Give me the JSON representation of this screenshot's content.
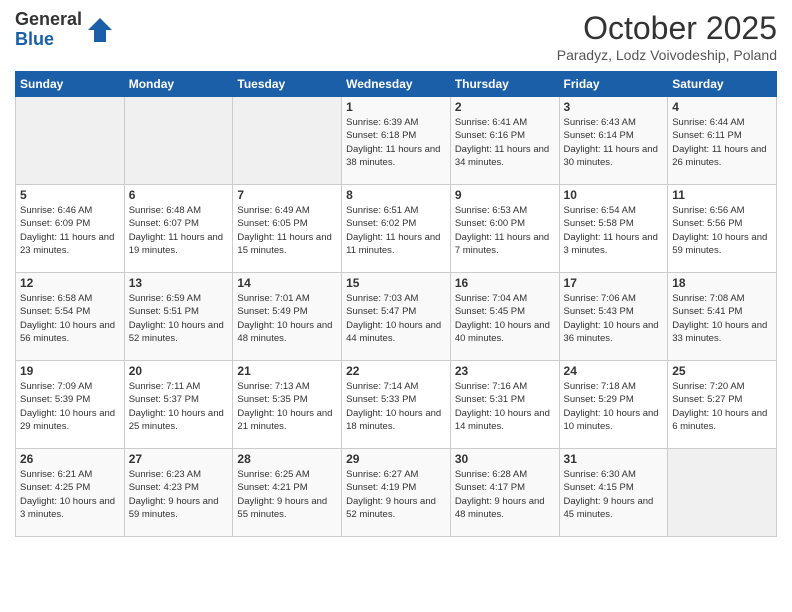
{
  "logo": {
    "general": "General",
    "blue": "Blue"
  },
  "header": {
    "month_title": "October 2025",
    "subtitle": "Paradyz, Lodz Voivodeship, Poland"
  },
  "weekdays": [
    "Sunday",
    "Monday",
    "Tuesday",
    "Wednesday",
    "Thursday",
    "Friday",
    "Saturday"
  ],
  "weeks": [
    [
      {
        "day": "",
        "empty": true
      },
      {
        "day": "",
        "empty": true
      },
      {
        "day": "",
        "empty": true
      },
      {
        "day": "1",
        "sunrise": "6:39 AM",
        "sunset": "6:18 PM",
        "daylight": "11 hours and 38 minutes."
      },
      {
        "day": "2",
        "sunrise": "6:41 AM",
        "sunset": "6:16 PM",
        "daylight": "11 hours and 34 minutes."
      },
      {
        "day": "3",
        "sunrise": "6:43 AM",
        "sunset": "6:14 PM",
        "daylight": "11 hours and 30 minutes."
      },
      {
        "day": "4",
        "sunrise": "6:44 AM",
        "sunset": "6:11 PM",
        "daylight": "11 hours and 26 minutes."
      }
    ],
    [
      {
        "day": "5",
        "sunrise": "6:46 AM",
        "sunset": "6:09 PM",
        "daylight": "11 hours and 23 minutes."
      },
      {
        "day": "6",
        "sunrise": "6:48 AM",
        "sunset": "6:07 PM",
        "daylight": "11 hours and 19 minutes."
      },
      {
        "day": "7",
        "sunrise": "6:49 AM",
        "sunset": "6:05 PM",
        "daylight": "11 hours and 15 minutes."
      },
      {
        "day": "8",
        "sunrise": "6:51 AM",
        "sunset": "6:02 PM",
        "daylight": "11 hours and 11 minutes."
      },
      {
        "day": "9",
        "sunrise": "6:53 AM",
        "sunset": "6:00 PM",
        "daylight": "11 hours and 7 minutes."
      },
      {
        "day": "10",
        "sunrise": "6:54 AM",
        "sunset": "5:58 PM",
        "daylight": "11 hours and 3 minutes."
      },
      {
        "day": "11",
        "sunrise": "6:56 AM",
        "sunset": "5:56 PM",
        "daylight": "10 hours and 59 minutes."
      }
    ],
    [
      {
        "day": "12",
        "sunrise": "6:58 AM",
        "sunset": "5:54 PM",
        "daylight": "10 hours and 56 minutes."
      },
      {
        "day": "13",
        "sunrise": "6:59 AM",
        "sunset": "5:51 PM",
        "daylight": "10 hours and 52 minutes."
      },
      {
        "day": "14",
        "sunrise": "7:01 AM",
        "sunset": "5:49 PM",
        "daylight": "10 hours and 48 minutes."
      },
      {
        "day": "15",
        "sunrise": "7:03 AM",
        "sunset": "5:47 PM",
        "daylight": "10 hours and 44 minutes."
      },
      {
        "day": "16",
        "sunrise": "7:04 AM",
        "sunset": "5:45 PM",
        "daylight": "10 hours and 40 minutes."
      },
      {
        "day": "17",
        "sunrise": "7:06 AM",
        "sunset": "5:43 PM",
        "daylight": "10 hours and 36 minutes."
      },
      {
        "day": "18",
        "sunrise": "7:08 AM",
        "sunset": "5:41 PM",
        "daylight": "10 hours and 33 minutes."
      }
    ],
    [
      {
        "day": "19",
        "sunrise": "7:09 AM",
        "sunset": "5:39 PM",
        "daylight": "10 hours and 29 minutes."
      },
      {
        "day": "20",
        "sunrise": "7:11 AM",
        "sunset": "5:37 PM",
        "daylight": "10 hours and 25 minutes."
      },
      {
        "day": "21",
        "sunrise": "7:13 AM",
        "sunset": "5:35 PM",
        "daylight": "10 hours and 21 minutes."
      },
      {
        "day": "22",
        "sunrise": "7:14 AM",
        "sunset": "5:33 PM",
        "daylight": "10 hours and 18 minutes."
      },
      {
        "day": "23",
        "sunrise": "7:16 AM",
        "sunset": "5:31 PM",
        "daylight": "10 hours and 14 minutes."
      },
      {
        "day": "24",
        "sunrise": "7:18 AM",
        "sunset": "5:29 PM",
        "daylight": "10 hours and 10 minutes."
      },
      {
        "day": "25",
        "sunrise": "7:20 AM",
        "sunset": "5:27 PM",
        "daylight": "10 hours and 6 minutes."
      }
    ],
    [
      {
        "day": "26",
        "sunrise": "6:21 AM",
        "sunset": "4:25 PM",
        "daylight": "10 hours and 3 minutes."
      },
      {
        "day": "27",
        "sunrise": "6:23 AM",
        "sunset": "4:23 PM",
        "daylight": "9 hours and 59 minutes."
      },
      {
        "day": "28",
        "sunrise": "6:25 AM",
        "sunset": "4:21 PM",
        "daylight": "9 hours and 55 minutes."
      },
      {
        "day": "29",
        "sunrise": "6:27 AM",
        "sunset": "4:19 PM",
        "daylight": "9 hours and 52 minutes."
      },
      {
        "day": "30",
        "sunrise": "6:28 AM",
        "sunset": "4:17 PM",
        "daylight": "9 hours and 48 minutes."
      },
      {
        "day": "31",
        "sunrise": "6:30 AM",
        "sunset": "4:15 PM",
        "daylight": "9 hours and 45 minutes."
      },
      {
        "day": "",
        "empty": true
      }
    ]
  ],
  "labels": {
    "sunrise": "Sunrise:",
    "sunset": "Sunset:",
    "daylight": "Daylight:"
  }
}
